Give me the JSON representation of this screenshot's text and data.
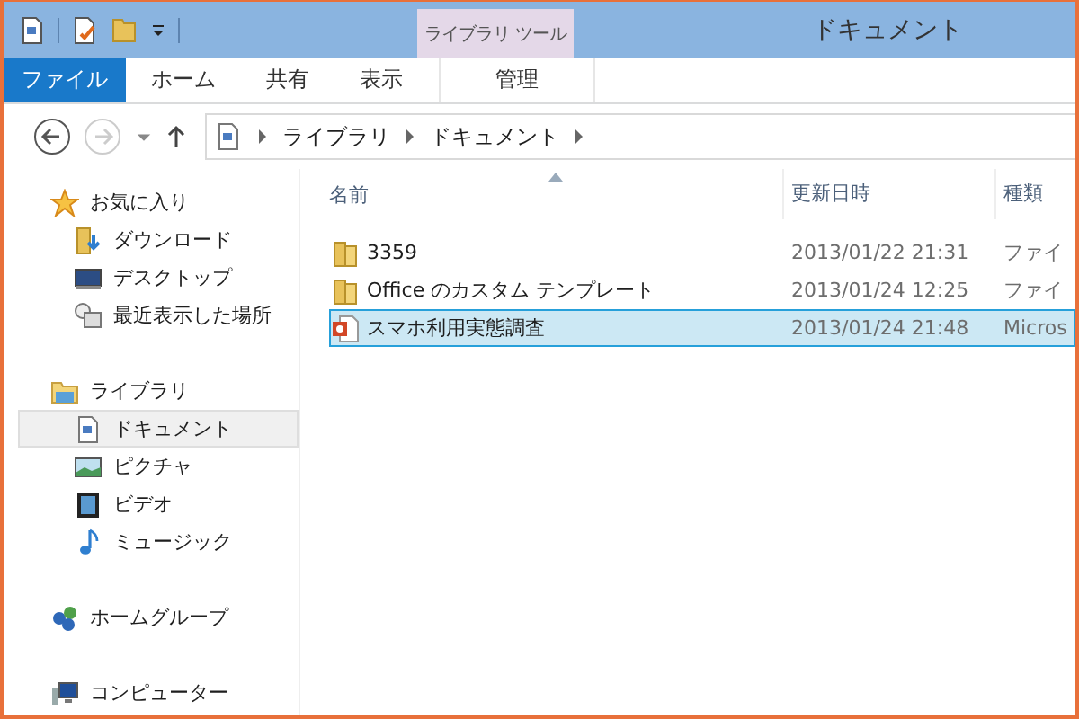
{
  "window": {
    "title": "ドキュメント"
  },
  "quick_access": {
    "context_label": "ライブラリ ツール"
  },
  "ribbon_tabs": [
    {
      "label": "ファイル",
      "kind": "file"
    },
    {
      "label": "ホーム",
      "kind": "normal"
    },
    {
      "label": "共有",
      "kind": "normal"
    },
    {
      "label": "表示",
      "kind": "normal"
    },
    {
      "label": "管理",
      "kind": "context"
    }
  ],
  "address_bar": {
    "path": [
      "ライブラリ",
      "ドキュメント"
    ]
  },
  "sidebar": {
    "groups": [
      {
        "label": "お気に入り",
        "kind": "star",
        "children": [
          {
            "label": "ダウンロード",
            "kind": "download",
            "selected": false
          },
          {
            "label": "デスクトップ",
            "kind": "desktop",
            "selected": false
          },
          {
            "label": "最近表示した場所",
            "kind": "recent",
            "selected": false
          }
        ]
      },
      {
        "label": "ライブラリ",
        "kind": "library",
        "children": [
          {
            "label": "ドキュメント",
            "kind": "document",
            "selected": true
          },
          {
            "label": "ピクチャ",
            "kind": "picture",
            "selected": false
          },
          {
            "label": "ビデオ",
            "kind": "video",
            "selected": false
          },
          {
            "label": "ミュージック",
            "kind": "music",
            "selected": false
          }
        ]
      },
      {
        "label": "ホームグループ",
        "kind": "homegroup"
      },
      {
        "label": "コンピューター",
        "kind": "computer"
      }
    ]
  },
  "file_list": {
    "columns": [
      "名前",
      "更新日時",
      "種類"
    ],
    "rows": [
      {
        "name": "3359",
        "date": "2013/01/22 21:31",
        "type": "ファイ",
        "kind": "folder",
        "selected": false
      },
      {
        "name": "Office のカスタム テンプレート",
        "date": "2013/01/24 12:25",
        "type": "ファイ",
        "kind": "folder",
        "selected": false
      },
      {
        "name": "スマホ利用実態調査",
        "date": "2013/01/24 21:48",
        "type": "Micros",
        "kind": "presentation",
        "selected": true
      }
    ]
  }
}
